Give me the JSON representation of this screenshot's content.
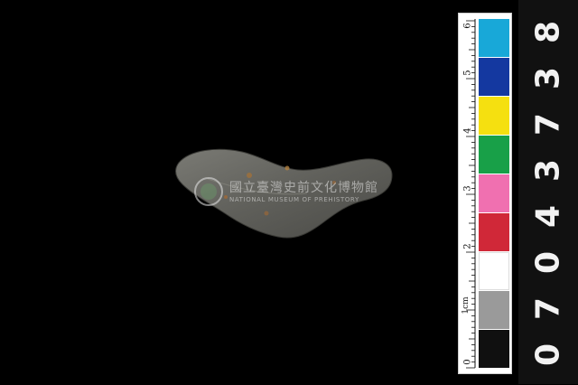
{
  "watermark": {
    "name_zh": "國立臺灣史前文化博物館",
    "name_en": "NATIONAL MUSEUM OF PREHISTORY"
  },
  "scale_bar": {
    "unit_label": "1cm",
    "numbers": [
      "0",
      "2",
      "3",
      "4",
      "5",
      "6"
    ],
    "swatch_colors": [
      "#18a8d8",
      "#1438a0",
      "#f5e010",
      "#18a048",
      "#f070b0",
      "#d02838",
      "#ffffff",
      "#9a9a9a",
      "#101010"
    ]
  },
  "catalog_number": {
    "digits": [
      "0",
      "7",
      "0",
      "4",
      "3",
      "7",
      "3",
      "8"
    ]
  }
}
